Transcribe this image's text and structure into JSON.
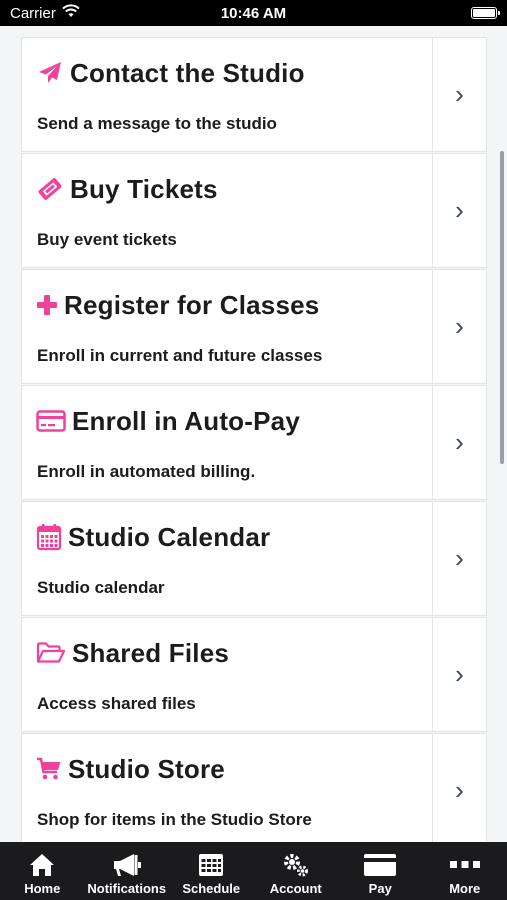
{
  "status_bar": {
    "carrier": "Carrier",
    "time": "10:46 AM"
  },
  "accent_color": "#f0419b",
  "items": [
    {
      "icon": "paper-plane-icon",
      "title": "Contact the Studio",
      "subtitle": "Send a message to the studio"
    },
    {
      "icon": "ticket-icon",
      "title": "Buy Tickets",
      "subtitle": "Buy event tickets"
    },
    {
      "icon": "plus-icon",
      "title": "Register for Classes",
      "subtitle": "Enroll in current and future classes"
    },
    {
      "icon": "credit-card-icon",
      "title": "Enroll in Auto-Pay",
      "subtitle": "Enroll in automated billing."
    },
    {
      "icon": "calendar-icon",
      "title": "Studio Calendar",
      "subtitle": "Studio calendar"
    },
    {
      "icon": "folder-open-icon",
      "title": "Shared Files",
      "subtitle": "Access shared files"
    },
    {
      "icon": "shopping-cart-icon",
      "title": "Studio Store",
      "subtitle": "Shop for items in the Studio Store"
    }
  ],
  "chevron": "›",
  "tabs": [
    {
      "icon": "home-icon",
      "label": "Home"
    },
    {
      "icon": "megaphone-icon",
      "label": "Notifications"
    },
    {
      "icon": "schedule-icon",
      "label": "Schedule"
    },
    {
      "icon": "gears-icon",
      "label": "Account"
    },
    {
      "icon": "card-icon",
      "label": "Pay"
    },
    {
      "icon": "more-icon",
      "label": "More"
    }
  ]
}
